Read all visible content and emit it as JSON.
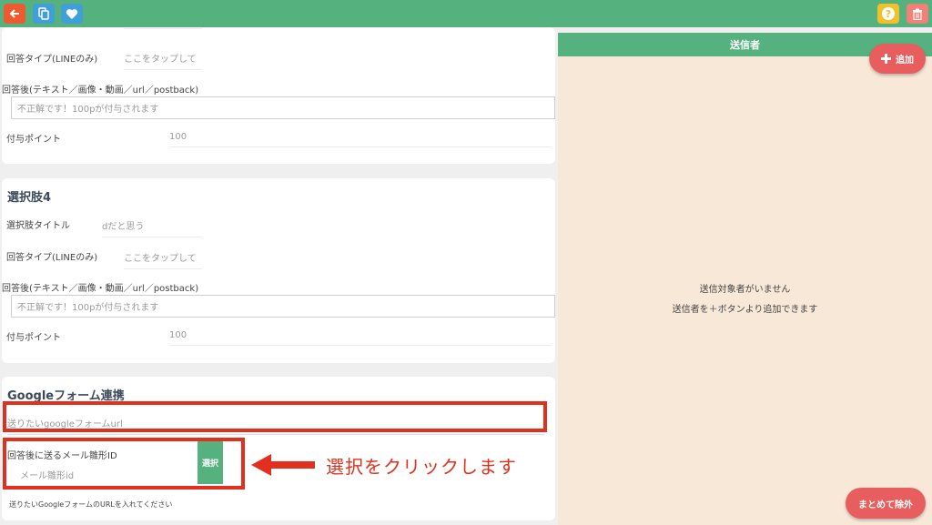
{
  "colors": {
    "primary_green": "#55b27f",
    "back_orange": "#ee5a2f",
    "icon_blue": "#3f9fd6",
    "help_yellow": "#f0c12b",
    "trash_pink": "#f08078",
    "action_red": "#e85d5d",
    "annotation_red": "#e2301e",
    "panel_bg": "#f8e8d8"
  },
  "toolbar": {
    "icons": [
      "arrow-left-icon",
      "copy-icon",
      "heart-icon",
      "help-icon",
      "trash-icon"
    ]
  },
  "card1": {
    "answer_type_label": "回答タイプ(LINEのみ)",
    "answer_type_placeholder": "ここをタップして",
    "after_answer_label": "回答後(テキスト／画像・動画／url／postback)",
    "after_answer_value": "不正解です！100pが付与されます",
    "points_label": "付与ポイント",
    "points_value": "100"
  },
  "card2": {
    "title": "選択肢4",
    "choice_title_label": "選択肢タイトル",
    "choice_title_value": "dだと思う",
    "answer_type_label": "回答タイプ(LINEのみ)",
    "answer_type_placeholder": "ここをタップして",
    "after_answer_label": "回答後(テキスト／画像・動画／url／postback)",
    "after_answer_value": "不正解です！100pが付与されます",
    "points_label": "付与ポイント",
    "points_value": "100"
  },
  "google_form": {
    "title": "Googleフォーム連携",
    "url_placeholder": "送りたいgoogleフォームurl",
    "mail_template_label": "回答後に送るメール雛形ID",
    "mail_template_placeholder": "メール雛形id",
    "select_label": "選択",
    "hint": "送りたいGoogleフォームのURLを入れてください"
  },
  "annotation": {
    "text": "選択をクリックします"
  },
  "senders": {
    "header": "送信者",
    "add_label": "追加",
    "empty_line1": "送信対象者がいません",
    "empty_line2": "送信者を＋ボタンより追加できます",
    "bulk_remove_label": "まとめて除外"
  }
}
